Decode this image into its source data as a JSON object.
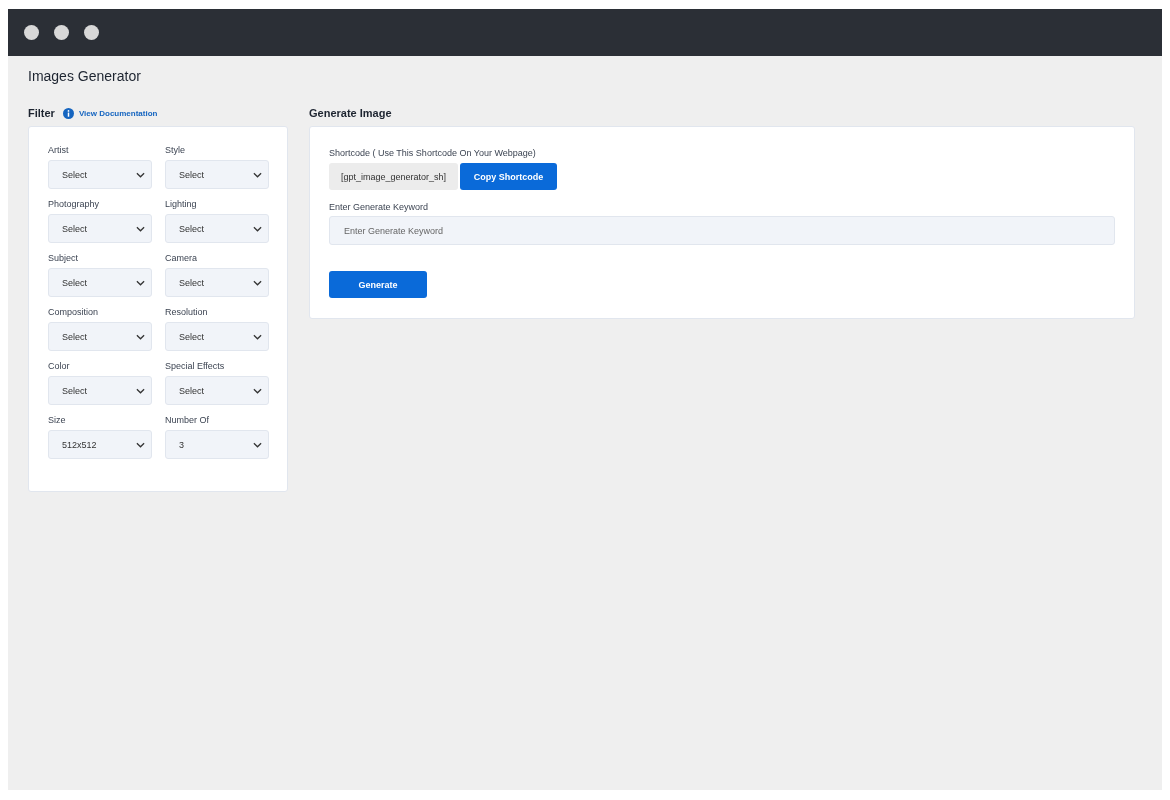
{
  "page_title": "Images Generator",
  "filter": {
    "title": "Filter",
    "doc_link": "View Documentation",
    "fields": [
      {
        "label": "Artist",
        "value": "Select"
      },
      {
        "label": "Style",
        "value": "Select"
      },
      {
        "label": "Photography",
        "value": "Select"
      },
      {
        "label": "Lighting",
        "value": "Select"
      },
      {
        "label": "Subject",
        "value": "Select"
      },
      {
        "label": "Camera",
        "value": "Select"
      },
      {
        "label": "Composition",
        "value": "Select"
      },
      {
        "label": "Resolution",
        "value": "Select"
      },
      {
        "label": "Color",
        "value": "Select"
      },
      {
        "label": "Special Effects",
        "value": "Select"
      },
      {
        "label": "Size",
        "value": "512x512"
      },
      {
        "label": "Number Of",
        "value": "3"
      }
    ]
  },
  "generate": {
    "title": "Generate Image",
    "shortcode_label": "Shortcode ( Use This Shortcode On Your Webpage)",
    "shortcode": "[gpt_image_generator_sh]",
    "copy_button": "Copy Shortcode",
    "keyword_label": "Enter Generate Keyword",
    "keyword_placeholder": "Enter Generate Keyword",
    "generate_button": "Generate"
  }
}
